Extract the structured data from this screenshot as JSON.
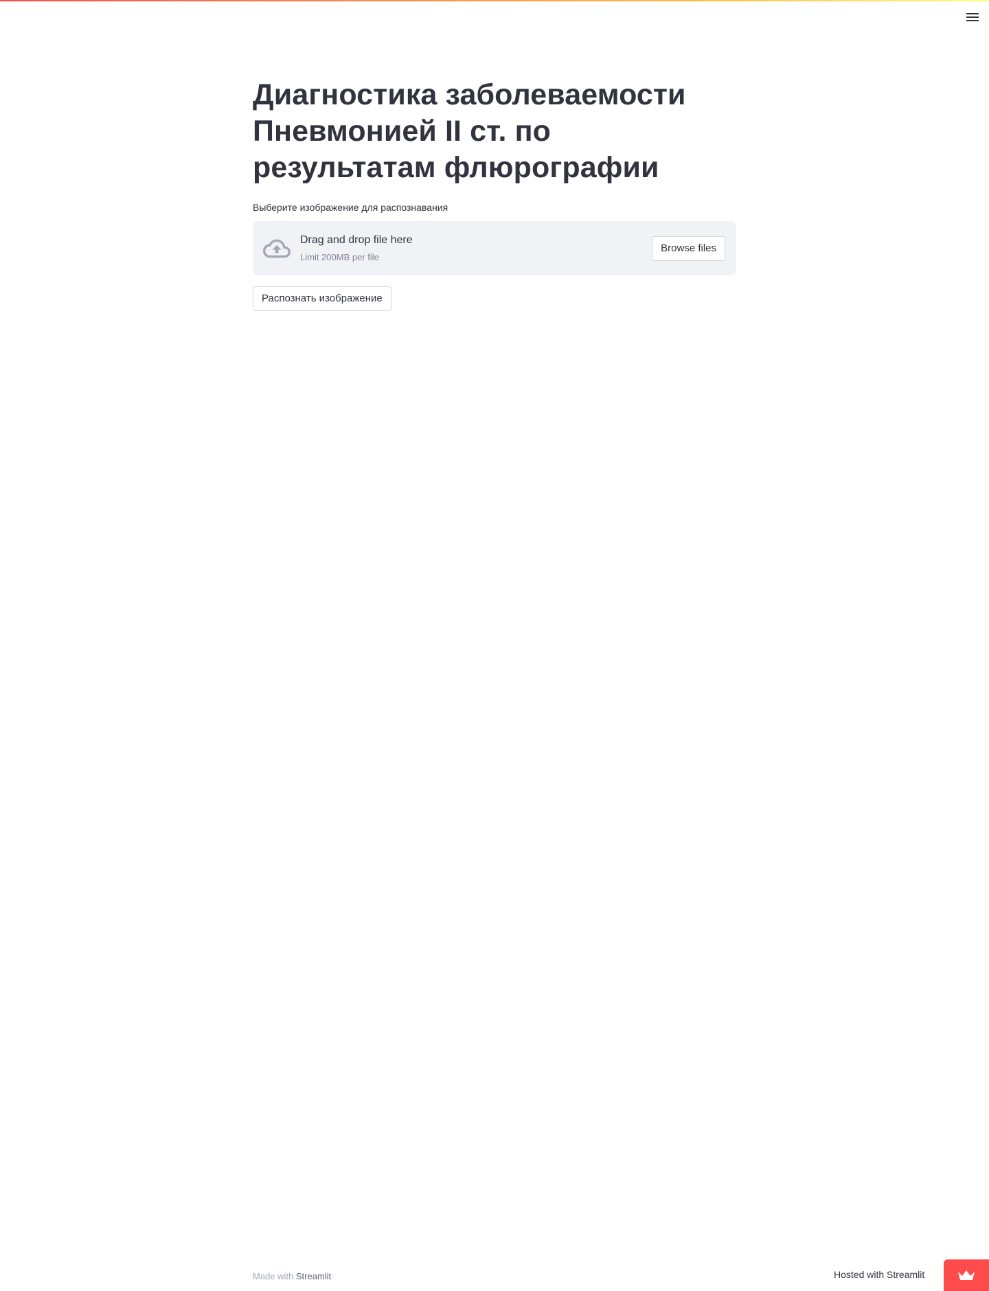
{
  "header": {
    "menu_icon": "hamburger-menu-icon"
  },
  "main": {
    "title": "Диагностика заболеваемости Пневмонией II ст. по результатам флюрографии",
    "uploader": {
      "label": "Выберите изображение для распознавания",
      "icon": "cloud-upload-icon",
      "instructions": "Drag and drop file here",
      "limit": "Limit 200MB per file",
      "browse_label": "Browse files"
    },
    "recognize_label": "Распознать изображение"
  },
  "footer": {
    "made_with": "Made with",
    "brand": "Streamlit",
    "hosted_label": "Hosted with Streamlit",
    "hosted_icon": "streamlit-crown-icon"
  },
  "colors": {
    "accent": "#ff4b4b",
    "text": "#31333f",
    "dropzone_bg": "#f0f2f6",
    "muted": "#808495"
  }
}
